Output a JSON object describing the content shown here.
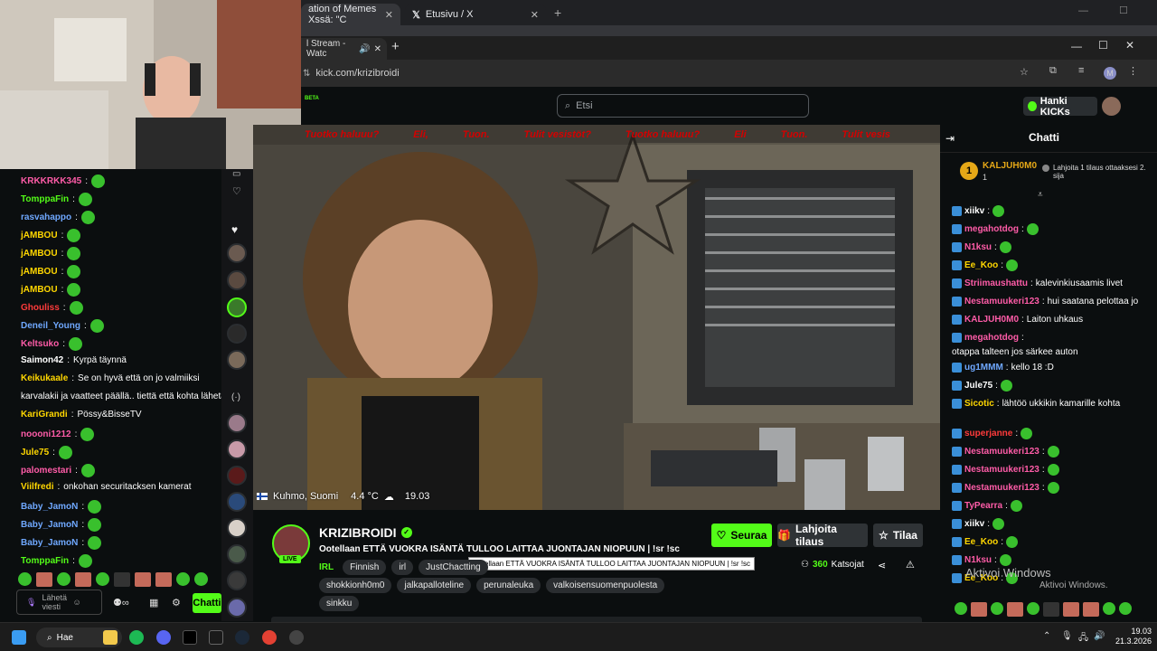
{
  "outer_browser": {
    "tabs": [
      {
        "label": "ation of Memes Xssä: \"C"
      },
      {
        "label": "Etusivu / X"
      }
    ]
  },
  "inner_browser": {
    "tab": {
      "label": "l Stream - Watc"
    },
    "url": "kick.com/krizibroidi"
  },
  "header": {
    "search_placeholder": "Etsi",
    "kicks_label": "Hanki KICKs"
  },
  "video": {
    "ticker": [
      "Tuotko haluuu?",
      "Eli,",
      "Tuon.",
      "Tulit vesistöt?",
      "Tuotko haluuu?",
      "Eli",
      "Tuon.",
      "Tulit vesis"
    ],
    "location": "Kuhmo, Suomi",
    "temperature": "4.4 °C",
    "time": "19.03"
  },
  "stream": {
    "name": "KRIZIBROIDI",
    "live_label": "LIVE",
    "title": "Ootellaan ETTÄ VUOKRA ISÄNTÄ TULLOO LAITTAA JUONTAJAN NIOPUUN | !sr !sc",
    "tooltip": "Ootellaan ETTÄ VUOKRA ISÄNTÄ TULLOO LAITTAA JUONTAJAN NIOPUUN | !sr !sc",
    "category": "IRL",
    "tags_row1": [
      "Finnish",
      "irl",
      "JustChactting"
    ],
    "tags_row2": [
      "shokkionh0m0",
      "jalkapalloteline",
      "perunaleuka",
      "valkoisensuomenpuolesta"
    ],
    "tags_row3": [
      "sinkku"
    ],
    "follow_label": "Seuraa",
    "gift_label": "Lahjoita tilaus",
    "sub_label": "Tilaa",
    "viewers": "360",
    "viewers_label": "Katsojat"
  },
  "right_chat": {
    "title": "Chatti",
    "pinned_user": "KALJUH0M0",
    "pinned_count": "1",
    "pinned_text": "Lahjoita 1 tilaus ottaaksesi 2. sija",
    "messages": [
      {
        "user": "xiikv",
        "text": "",
        "color": "#ffffff"
      },
      {
        "user": "megahotdog",
        "text": "",
        "color": "#ff5ca8"
      },
      {
        "user": "N1ksu",
        "text": "",
        "color": "#ff5ca8"
      },
      {
        "user": "Ee_Koo",
        "text": "",
        "color": "#ffd700"
      },
      {
        "user": "Striimaushattu",
        "text": "kalevinkiusaamis livet",
        "color": "#ff5ca8"
      },
      {
        "user": "Nestamuukeri123",
        "text": "hui saatana pelottaa jo",
        "color": "#ff5ca8"
      },
      {
        "user": "KALJUH0M0",
        "text": "Laiton uhkaus",
        "color": "#ff5ca8"
      },
      {
        "user": "megahotdog",
        "text": "otappa talteen jos särkee auton",
        "color": "#ff5ca8"
      },
      {
        "user": "ug1MMM",
        "text": "kello 18 :D",
        "color": "#6fa8ff"
      },
      {
        "user": "Jule75",
        "text": "",
        "color": "#ffffff"
      },
      {
        "user": "Sicotic",
        "text": "lähtöö ukkikin kamarille kohta",
        "color": "#ffd700"
      },
      {
        "user": "superjanne",
        "text": "",
        "color": "#ff3b3b"
      },
      {
        "user": "Nestamuukeri123",
        "text": "",
        "color": "#ff5ca8"
      },
      {
        "user": "Nestamuukeri123",
        "text": "",
        "color": "#ff5ca8"
      },
      {
        "user": "Nestamuukeri123",
        "text": "",
        "color": "#ff5ca8"
      },
      {
        "user": "TyPearra",
        "text": "",
        "color": "#ff5ca8"
      },
      {
        "user": "xiikv",
        "text": "",
        "color": "#ffffff"
      },
      {
        "user": "Ee_Koo",
        "text": "",
        "color": "#ffd700"
      },
      {
        "user": "N1ksu",
        "text": "",
        "color": "#ff5ca8"
      },
      {
        "user": "Ee_Koo",
        "text": "",
        "color": "#ffd700"
      }
    ],
    "watermark_title": "Aktivoi Windows",
    "watermark_sub": "Aktivoi Windows."
  },
  "left_chat": {
    "messages": [
      {
        "user": "KRKKRKK345",
        "text": "",
        "color": "#ff5ca8"
      },
      {
        "user": "TomppaFin",
        "text": "",
        "color": "#53fc18"
      },
      {
        "user": "rasvahappo",
        "text": "",
        "color": "#6fa8ff"
      },
      {
        "user": "jAMBOU",
        "text": "",
        "color": "#ffd700"
      },
      {
        "user": "jAMBOU",
        "text": "",
        "color": "#ffd700"
      },
      {
        "user": "jAMBOU",
        "text": "",
        "color": "#ffd700"
      },
      {
        "user": "jAMBOU",
        "text": "",
        "color": "#ffd700"
      },
      {
        "user": "Ghouliss",
        "text": "",
        "color": "#ff3b3b"
      },
      {
        "user": "Deneil_Young",
        "text": "",
        "color": "#6fa8ff"
      },
      {
        "user": "Keltsuko",
        "text": "",
        "color": "#ff5ca8"
      },
      {
        "user": "Saimon42",
        "text": "Kyrpä täynnä",
        "color": "#ffffff"
      },
      {
        "user": "Keikukaale",
        "text": "Se on hyvä että on jo valmiiksi",
        "color": "#ffd700"
      },
      {
        "user": "",
        "text": "karvalakii ja vaatteet päällä.. tiettä että kohta lähetään",
        "color": "#ffffff"
      },
      {
        "user": "KariGrandi",
        "text": "Pössy&BisseTV",
        "color": "#ffd700"
      },
      {
        "user": "noooni1212",
        "text": "",
        "color": "#ff5ca8"
      },
      {
        "user": "Jule75",
        "text": "",
        "color": "#ffd700"
      },
      {
        "user": "palomestari",
        "text": "",
        "color": "#ff5ca8"
      },
      {
        "user": "Viilfredi",
        "text": "onkohan securitacksen kamerat",
        "color": "#ffd700"
      },
      {
        "user": "Baby_JamoN",
        "text": "",
        "color": "#6fa8ff"
      },
      {
        "user": "Baby_JamoN",
        "text": "",
        "color": "#6fa8ff"
      },
      {
        "user": "Baby_JamoN",
        "text": "",
        "color": "#6fa8ff"
      },
      {
        "user": "TomppaFin",
        "text": "",
        "color": "#53fc18"
      }
    ],
    "compose_placeholder": "Lähetä viesti",
    "chat_button": "Chatti"
  },
  "taskbar": {
    "search_label": "Hae",
    "clock_time": "19.03",
    "clock_date": "21.3.2026"
  },
  "colors": {
    "kick_green": "#53fc18",
    "bg": "#0b0e0f"
  }
}
